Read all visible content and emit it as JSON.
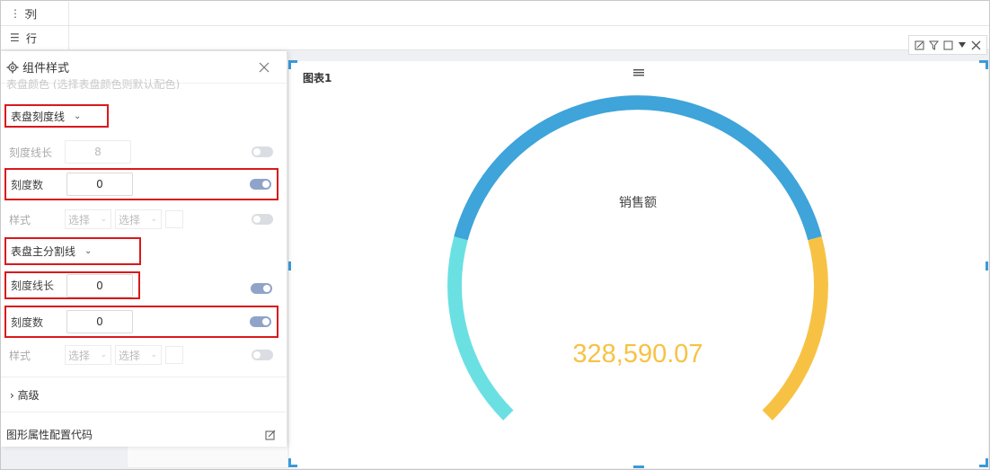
{
  "top_rows": {
    "columns_label": "列",
    "rows_label": "行"
  },
  "panel": {
    "title": "组件样式",
    "faded_text": "表盘颜色      (选择表盘颜色则默认配色)",
    "section_ticks": "表盘刻度线",
    "section_main_split": "表盘主分割线",
    "tick_length_label": "刻度线长",
    "tick_length_value": "8",
    "tick_count_label": "刻度数",
    "tick_count_value": "0",
    "style_label": "样式",
    "select_placeholder": "选择",
    "main_length_label": "刻度线长",
    "main_length_value": "0",
    "main_count_label": "刻度数",
    "main_count_value": "0",
    "style_label_2": "样式",
    "advanced": "高级",
    "code_config": "图形属性配置代码"
  },
  "chart": {
    "title": "图表1",
    "gauge_name": "销售额",
    "gauge_value": "328,590.07",
    "colors": {
      "main": "#3ea4da",
      "left": "#6be0e2",
      "right": "#f7c244",
      "value_text": "#f7c244",
      "accent": "#3b9ad8"
    }
  },
  "toolbar_icons": [
    "edit-icon",
    "filter-icon",
    "maximize-icon",
    "dropdown-icon",
    "close-icon"
  ]
}
